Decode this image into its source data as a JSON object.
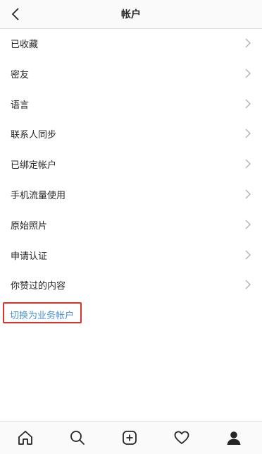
{
  "header": {
    "title": "帐户",
    "back_icon": "chevron-left-icon"
  },
  "menu": {
    "items": [
      {
        "label": "已收藏"
      },
      {
        "label": "密友"
      },
      {
        "label": "语言"
      },
      {
        "label": "联系人同步"
      },
      {
        "label": "已绑定帐户"
      },
      {
        "label": "手机流量使用"
      },
      {
        "label": "原始照片"
      },
      {
        "label": "申请认证"
      },
      {
        "label": "你赞过的内容"
      }
    ],
    "switch_account": {
      "label": "切换为业务帐户",
      "color": "#4a90d9",
      "highlight_color": "#d9342b"
    }
  },
  "tabbar": {
    "tabs": [
      {
        "icon": "home-icon"
      },
      {
        "icon": "search-icon"
      },
      {
        "icon": "add-post-icon"
      },
      {
        "icon": "heart-icon"
      },
      {
        "icon": "profile-icon"
      }
    ]
  }
}
